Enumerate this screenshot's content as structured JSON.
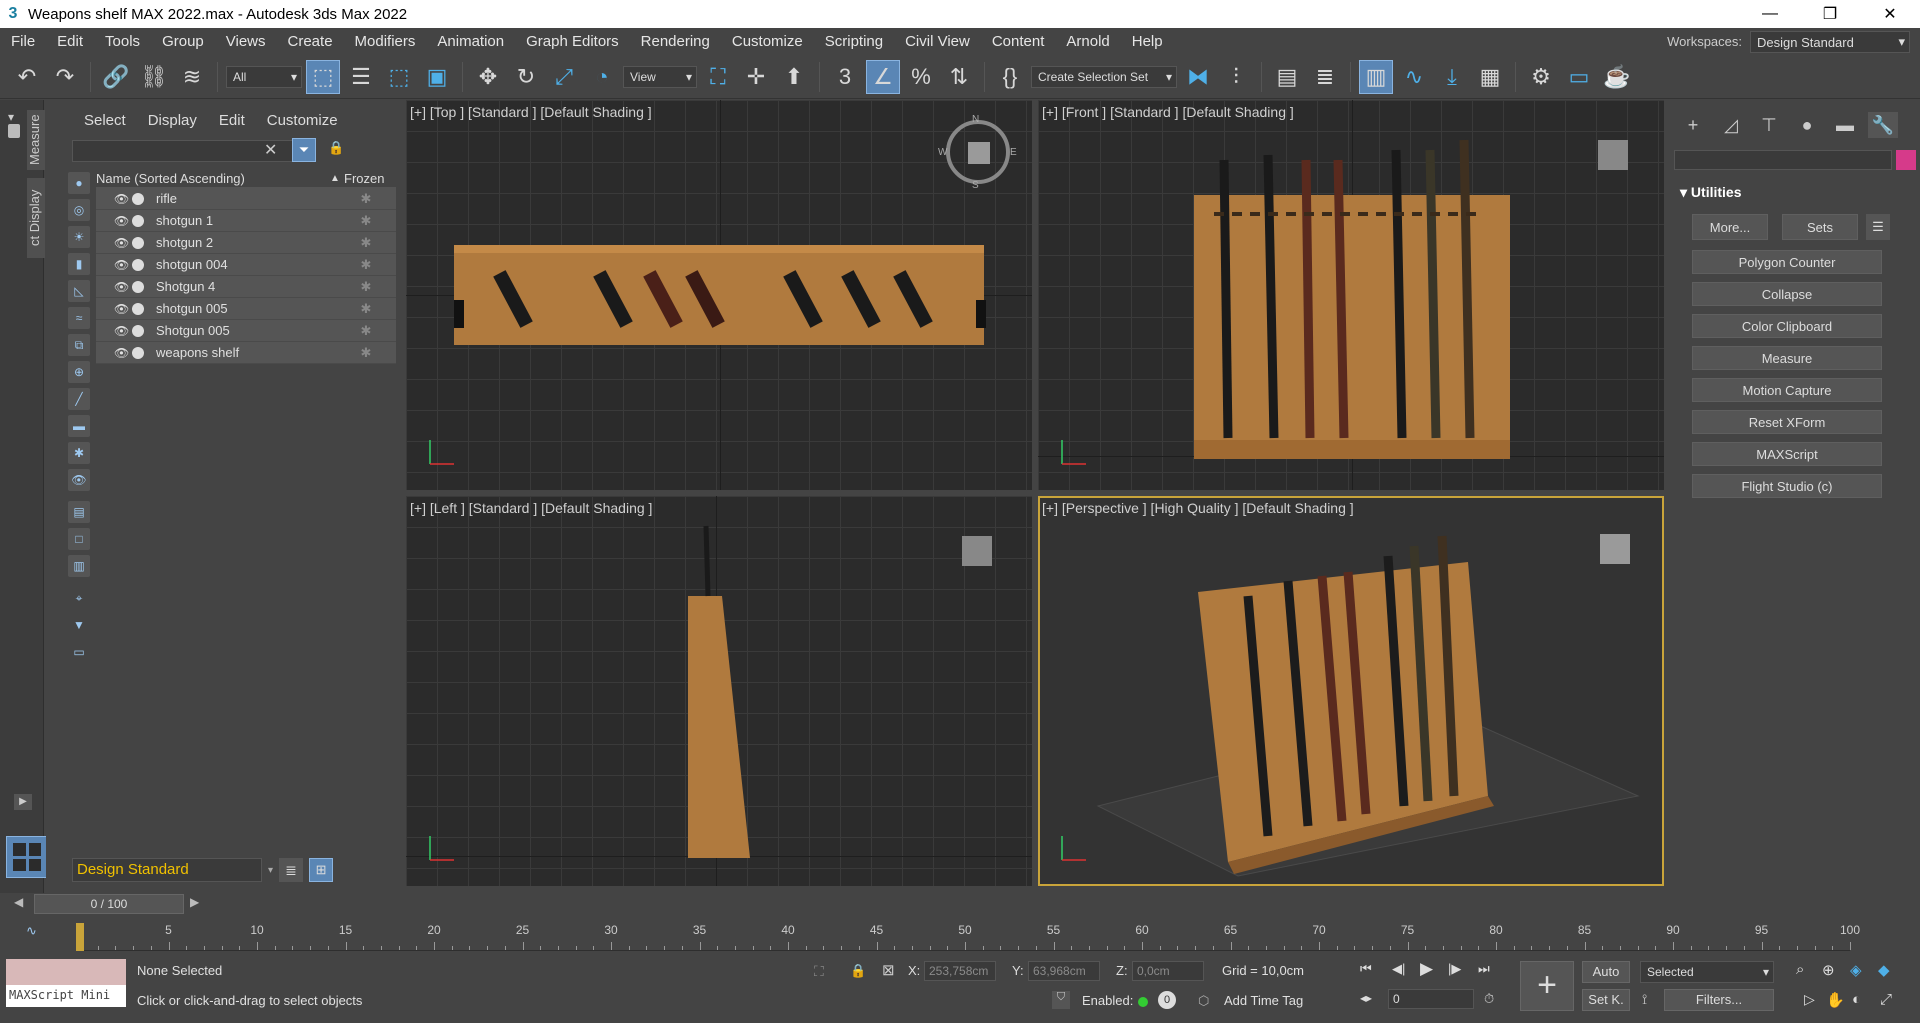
{
  "title": "Weapons shelf MAX 2022.max - Autodesk 3ds Max 2022",
  "menu": [
    "File",
    "Edit",
    "Tools",
    "Group",
    "Views",
    "Create",
    "Modifiers",
    "Animation",
    "Graph Editors",
    "Rendering",
    "Customize",
    "Scripting",
    "Civil View",
    "Content",
    "Arnold",
    "Help"
  ],
  "workspaces": {
    "label": "Workspaces:",
    "value": "Design Standard"
  },
  "toolbar": {
    "filter": "All",
    "ref_coord": "View",
    "selection_set": "Create Selection Set"
  },
  "left_tabs": {
    "measure": "Measure",
    "display": "ct Display"
  },
  "scene_explorer": {
    "menu": [
      "Select",
      "Display",
      "Edit",
      "Customize"
    ],
    "header_name": "Name (Sorted Ascending)",
    "header_frozen": "Frozen",
    "objects": [
      "rifle",
      "shotgun 1",
      "shotgun 2",
      "shotgun 004",
      "Shotgun 4",
      "shotgun 005",
      "Shotgun 005",
      "weapons shelf"
    ],
    "layer": "Design Standard"
  },
  "viewports": {
    "top": "[+] [Top ] [Standard ] [Default Shading ]",
    "front": "[+] [Front ] [Standard ] [Default Shading ]",
    "left": "[+] [Left ] [Standard ] [Default Shading ]",
    "perspective": "[+] [Perspective ] [High Quality ] [Default Shading ]"
  },
  "compass": {
    "n": "N",
    "w": "W",
    "e": "E",
    "s": "S"
  },
  "command_panel": {
    "section": "Utilities",
    "more": "More...",
    "sets": "Sets",
    "buttons": [
      "Polygon Counter",
      "Collapse",
      "Color Clipboard",
      "Measure",
      "Motion Capture",
      "Reset XForm",
      "MAXScript",
      "Flight Studio (c)"
    ],
    "accent": "#d63a8a"
  },
  "timeline": {
    "range": "0 / 100",
    "ticks": [
      0,
      5,
      10,
      15,
      20,
      25,
      30,
      35,
      40,
      45,
      50,
      55,
      60,
      65,
      70,
      75,
      80,
      85,
      90,
      95,
      100
    ]
  },
  "status": {
    "selected": "None Selected",
    "prompt": "Click or click-and-drag to select objects",
    "maxscript": "MAXScript Mini",
    "x_label": "X:",
    "x": "253,758cm",
    "y_label": "Y:",
    "y": "63,968cm",
    "z_label": "Z:",
    "z": "0,0cm",
    "grid": "Grid = 10,0cm",
    "enabled": "Enabled:",
    "add_time_tag": "Add Time Tag",
    "auto": "Auto",
    "set_k": "Set K.",
    "key_filter": "Selected",
    "filters": "Filters...",
    "frame": "0"
  }
}
